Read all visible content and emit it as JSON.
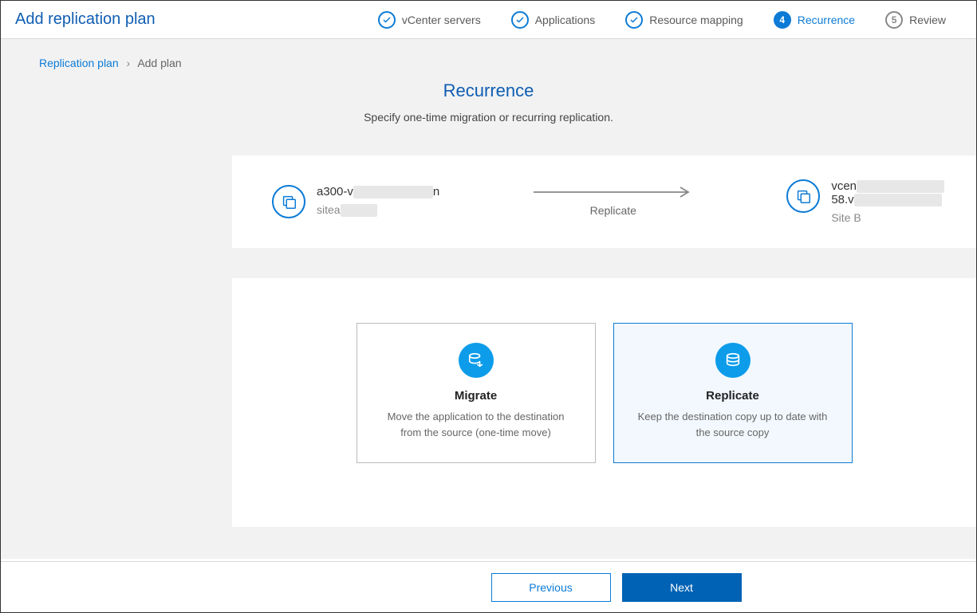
{
  "header": {
    "title": "Add replication plan"
  },
  "stepper": [
    {
      "label": "vCenter servers",
      "state": "done",
      "icon": "check"
    },
    {
      "label": "Applications",
      "state": "done",
      "icon": "check"
    },
    {
      "label": "Resource mapping",
      "state": "done",
      "icon": "check"
    },
    {
      "label": "Recurrence",
      "state": "active",
      "icon": "4"
    },
    {
      "label": "Review",
      "state": "pending",
      "icon": "5"
    }
  ],
  "breadcrumb": {
    "root": "Replication plan",
    "current": "Add plan"
  },
  "section": {
    "title": "Recurrence",
    "subtitle": "Specify one-time migration or recurring replication."
  },
  "sites": {
    "source": {
      "name_prefix": "a300-v",
      "sub_prefix": "sitea"
    },
    "arrow_label": "Replicate",
    "dest": {
      "name_prefix": "vcen",
      "name_suffix": "58.v",
      "sub": "Site B"
    }
  },
  "options": {
    "migrate": {
      "title": "Migrate",
      "desc": "Move the application to the destination from the source (one-time move)",
      "selected": false
    },
    "replicate": {
      "title": "Replicate",
      "desc": "Keep the destination copy up to date with the source copy",
      "selected": true
    }
  },
  "footer": {
    "previous": "Previous",
    "next": "Next"
  }
}
